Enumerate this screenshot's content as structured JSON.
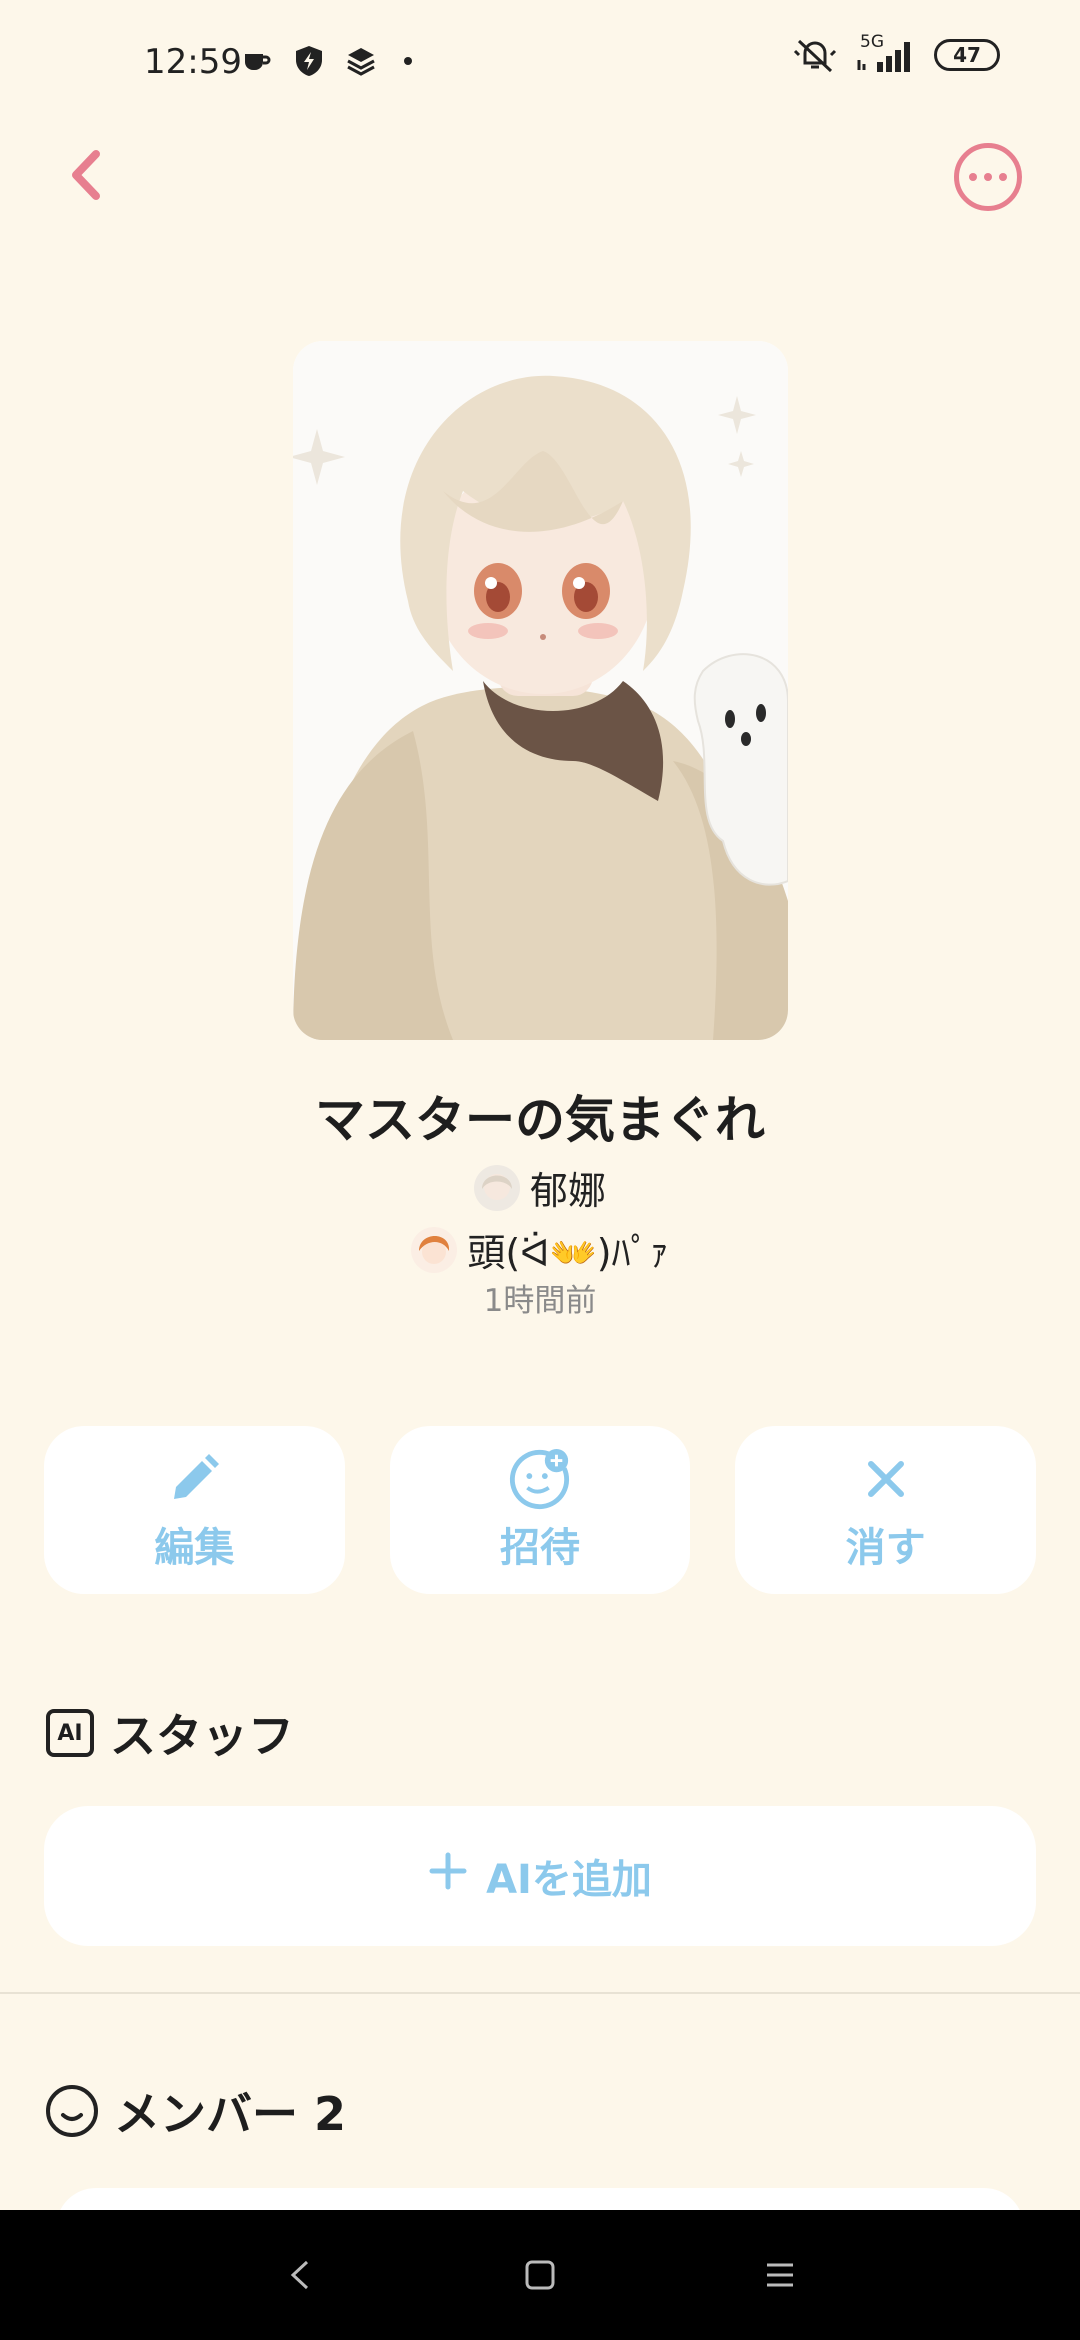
{
  "status_bar": {
    "time": "12:59",
    "network": "5G",
    "battery": "47",
    "icons_left": [
      "coffee-icon",
      "shield-bolt-icon",
      "layers-icon",
      "dot-icon"
    ],
    "icons_right": [
      "bell-off-icon",
      "signal-icon",
      "battery-icon"
    ]
  },
  "nav": {
    "back_icon": "chevron-left-icon",
    "more_icon": "more-horizontal-icon",
    "accent_color": "#e77f8f"
  },
  "chat": {
    "title": "マスターの気まぐれ",
    "owner_name": "郁娜",
    "second_name": "頭(ᐛ👐)ﾊﾟｧ",
    "time_ago": "1時間前"
  },
  "actions": [
    {
      "label": "編集",
      "icon": "pencil-icon"
    },
    {
      "label": "招待",
      "icon": "add-friend-icon"
    },
    {
      "label": "消す",
      "icon": "close-icon"
    }
  ],
  "staff": {
    "heading": "スタッフ",
    "icon_text": "AI",
    "add_label": "AIを追加"
  },
  "members": {
    "heading": "メンバー 2"
  },
  "theme": {
    "background": "#fdf7ea",
    "button_text": "#8cc9ec"
  }
}
